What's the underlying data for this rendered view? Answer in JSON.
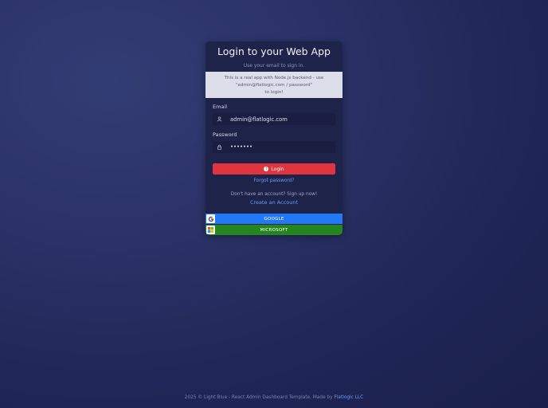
{
  "card": {
    "title": "Login to your Web App",
    "subtitle": "Use your email to sign in.",
    "info_lines": [
      "This is a real app with Node.js backend - use",
      "\"admin@flatlogic.com / password\"",
      "to login!"
    ]
  },
  "form": {
    "email_label": "Email",
    "email_value": "admin@flatlogic.com",
    "email_icon": "user-icon",
    "password_label": "Password",
    "password_value": "•••••••",
    "password_icon": "lock-icon",
    "login_label": "Login",
    "forgot_label": "Forgot password?",
    "signup_text": "Don't have an account? Sign up now!",
    "create_label": "Create an Account"
  },
  "social": {
    "google_label": "GOOGLE",
    "microsoft_label": "MICROSOFT"
  },
  "footer": {
    "text": "2025 © Light Blue - React Admin Dashboard Template. Made by",
    "link": "Flatlogic LLC"
  },
  "colors": {
    "login": "#e0343f",
    "google": "#2378f5",
    "microsoft": "#25861f",
    "link": "#6e9cf0"
  }
}
